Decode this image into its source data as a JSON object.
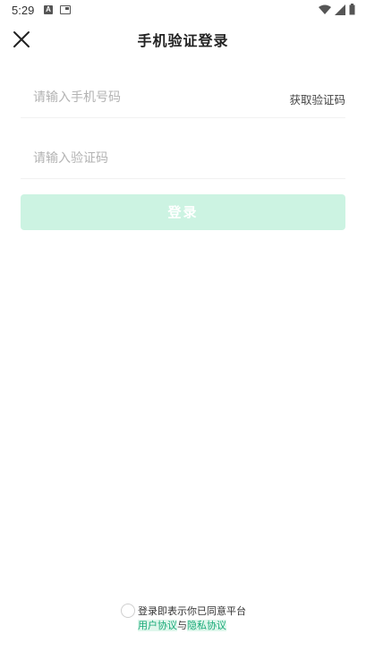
{
  "status_bar": {
    "time": "5:29",
    "icon_a_letter": "A"
  },
  "header": {
    "title": "手机验证登录"
  },
  "form": {
    "phone_placeholder": "请输入手机号码",
    "get_code_label": "获取验证码",
    "code_placeholder": "请输入验证码",
    "login_label": "登录"
  },
  "agreement": {
    "text": "登录即表示你已同意平台",
    "user_link": "用户协议",
    "conjunction": "与",
    "privacy_link": "隐私协议"
  },
  "colors": {
    "accent": "#19a978",
    "button_disabled": "#ccf3e2",
    "placeholder": "#b3b3b3"
  }
}
